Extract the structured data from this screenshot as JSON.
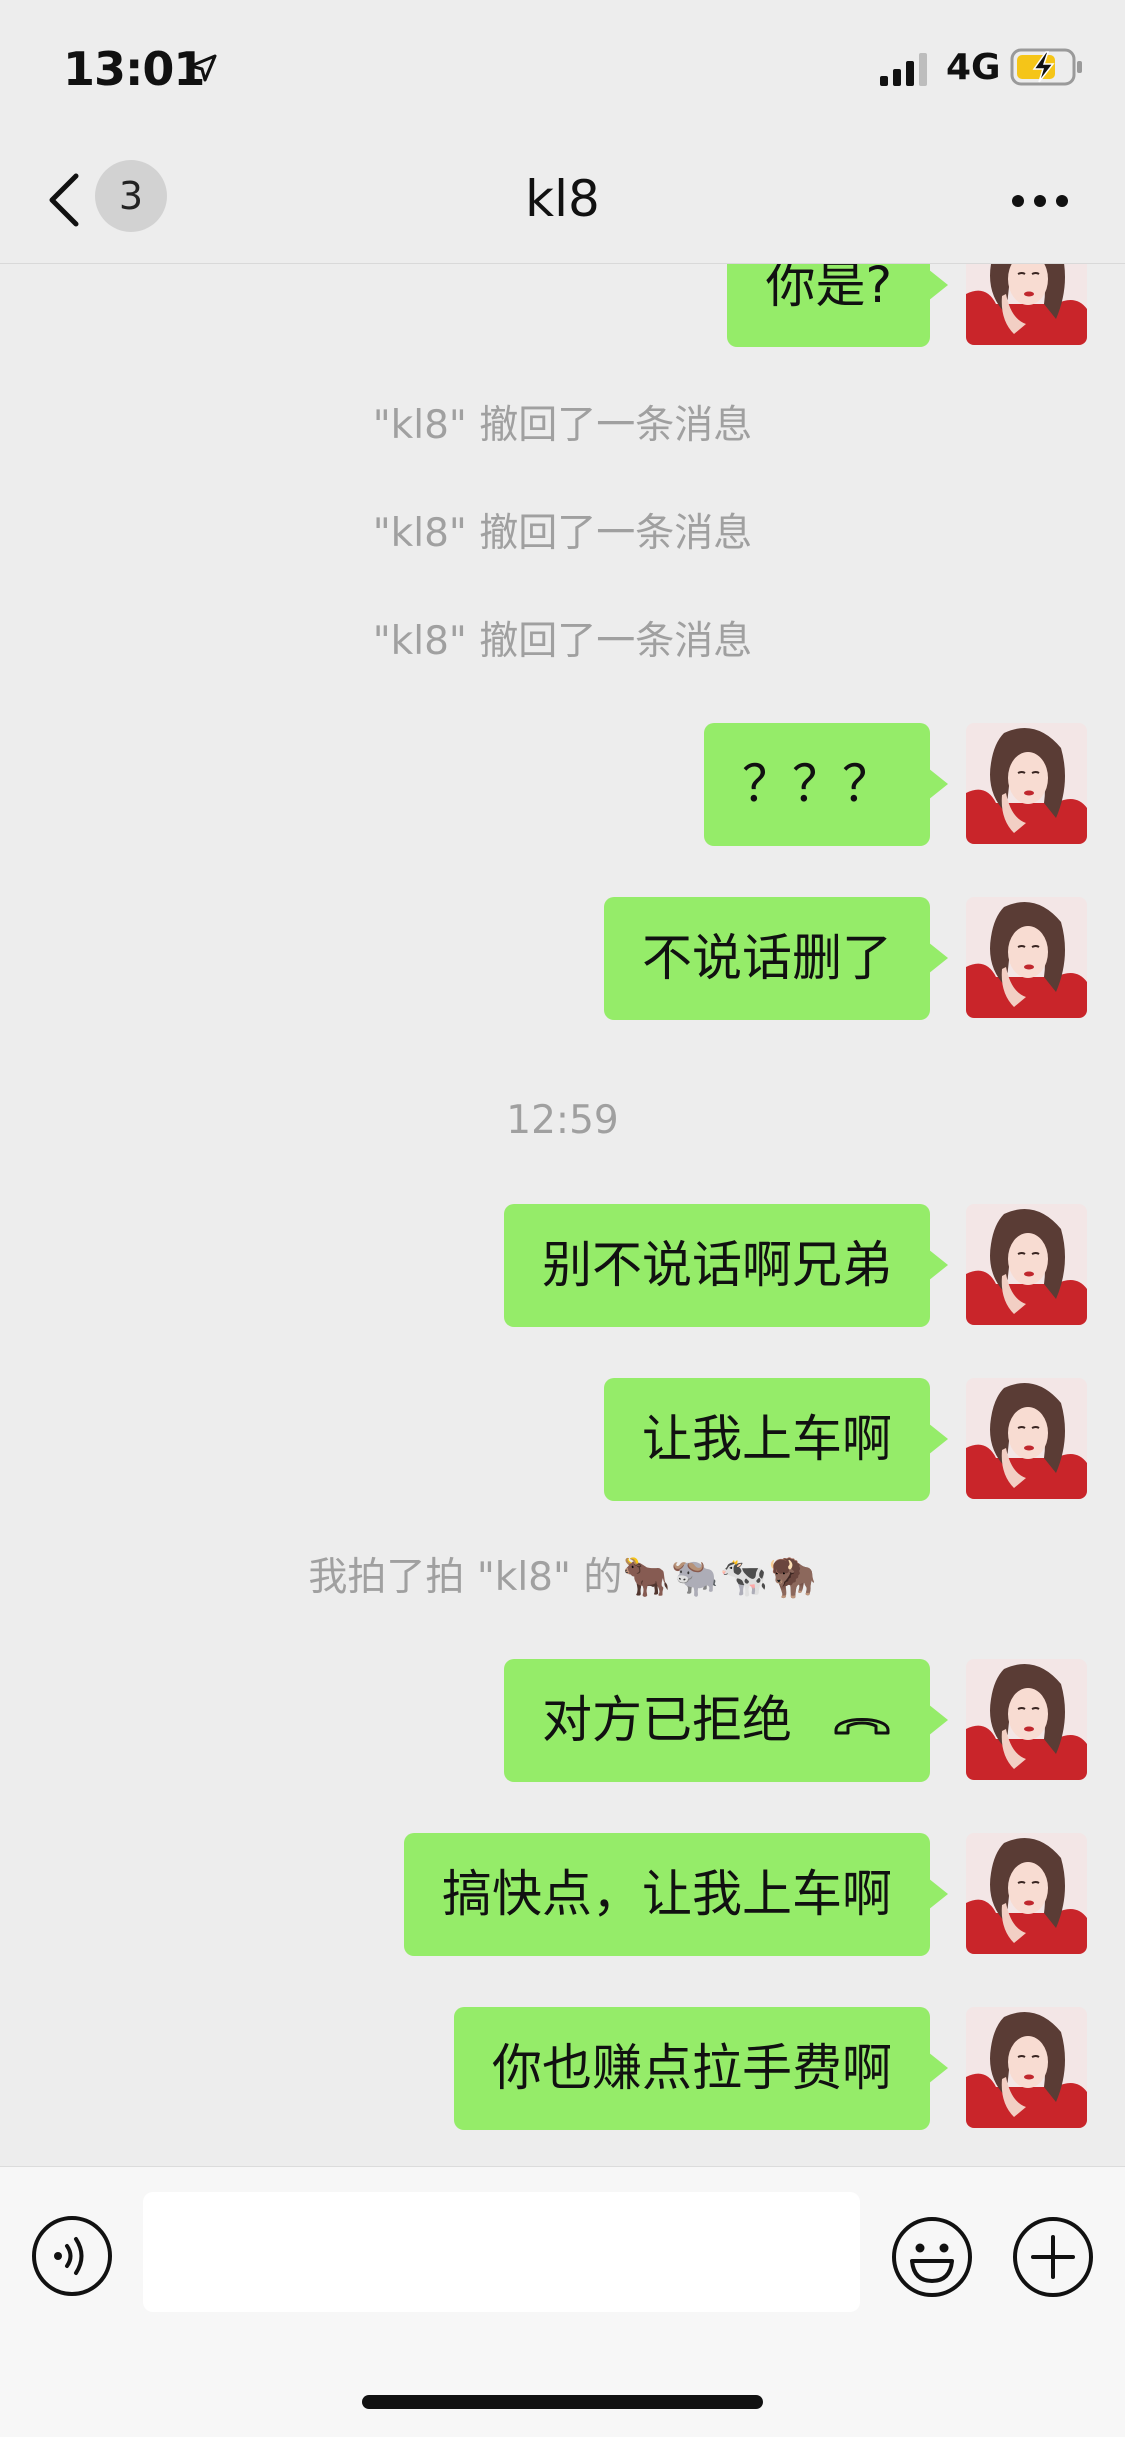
{
  "status_bar": {
    "time": "13:01",
    "network": "4G"
  },
  "nav": {
    "badge_count": "3",
    "title": "kl8"
  },
  "messages": [
    {
      "type": "sent",
      "text": "你是?"
    },
    {
      "type": "system",
      "text": "\"kl8\" 撤回了一条消息"
    },
    {
      "type": "system",
      "text": "\"kl8\" 撤回了一条消息"
    },
    {
      "type": "system",
      "text": "\"kl8\" 撤回了一条消息"
    },
    {
      "type": "sent",
      "text": "？？？"
    },
    {
      "type": "sent",
      "text": "不说话删了"
    },
    {
      "type": "timestamp",
      "text": "12:59"
    },
    {
      "type": "sent",
      "text": "别不说话啊兄弟"
    },
    {
      "type": "sent",
      "text": "让我上车啊"
    },
    {
      "type": "system",
      "text": "我拍了拍 \"kl8\" 的🐂🐃🐄🦬"
    },
    {
      "type": "sent_call",
      "text": "对方已拒绝",
      "icon": "hang-up-icon"
    },
    {
      "type": "sent",
      "text": "搞快点，让我上车啊"
    },
    {
      "type": "sent",
      "text": "你也赚点拉手费啊"
    }
  ],
  "input": {
    "value": "",
    "placeholder": ""
  },
  "colors": {
    "bubble": "#95ec69",
    "background": "#ededed",
    "system_text": "#a0a0a0"
  }
}
